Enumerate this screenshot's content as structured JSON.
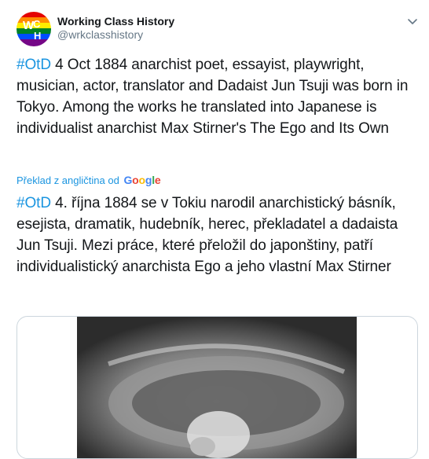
{
  "account": {
    "display_name": "Working Class History",
    "handle": "@wrkclasshistory",
    "avatar_letters": "WCH",
    "avatar_colors": [
      "#e40303",
      "#ff8c00",
      "#ffed00",
      "#008026",
      "#004dff",
      "#750787"
    ]
  },
  "tweet": {
    "original": {
      "hashtag": "#OtD",
      "text": " 4 Oct 1884 anarchist poet, essayist, playwright, musician, actor, translator and Dadaist Jun Tsuji was born in Tokyo. Among the works he translated into Japanese is individualist anarchist Max Stirner's The Ego and Its Own"
    },
    "translation_note": "Překlad z angličtina od",
    "translation_provider": "Google",
    "translated": {
      "hashtag": "#OtD",
      "text": " 4. října 1884 se v Tokiu narodil anarchistický básník, esejista, dramatik, hudebník, herec, překladatel a dadaista Jun Tsuji. Mezi práce, které přeložil do japonštiny, patří individualistický anarchista Ego a jeho vlastní Max Stirner"
    }
  },
  "colors": {
    "link": "#1b95e0",
    "text": "#14171a",
    "muted": "#657786",
    "border": "#ccd6dd"
  },
  "icons": {
    "menu": "chevron-down-icon"
  }
}
